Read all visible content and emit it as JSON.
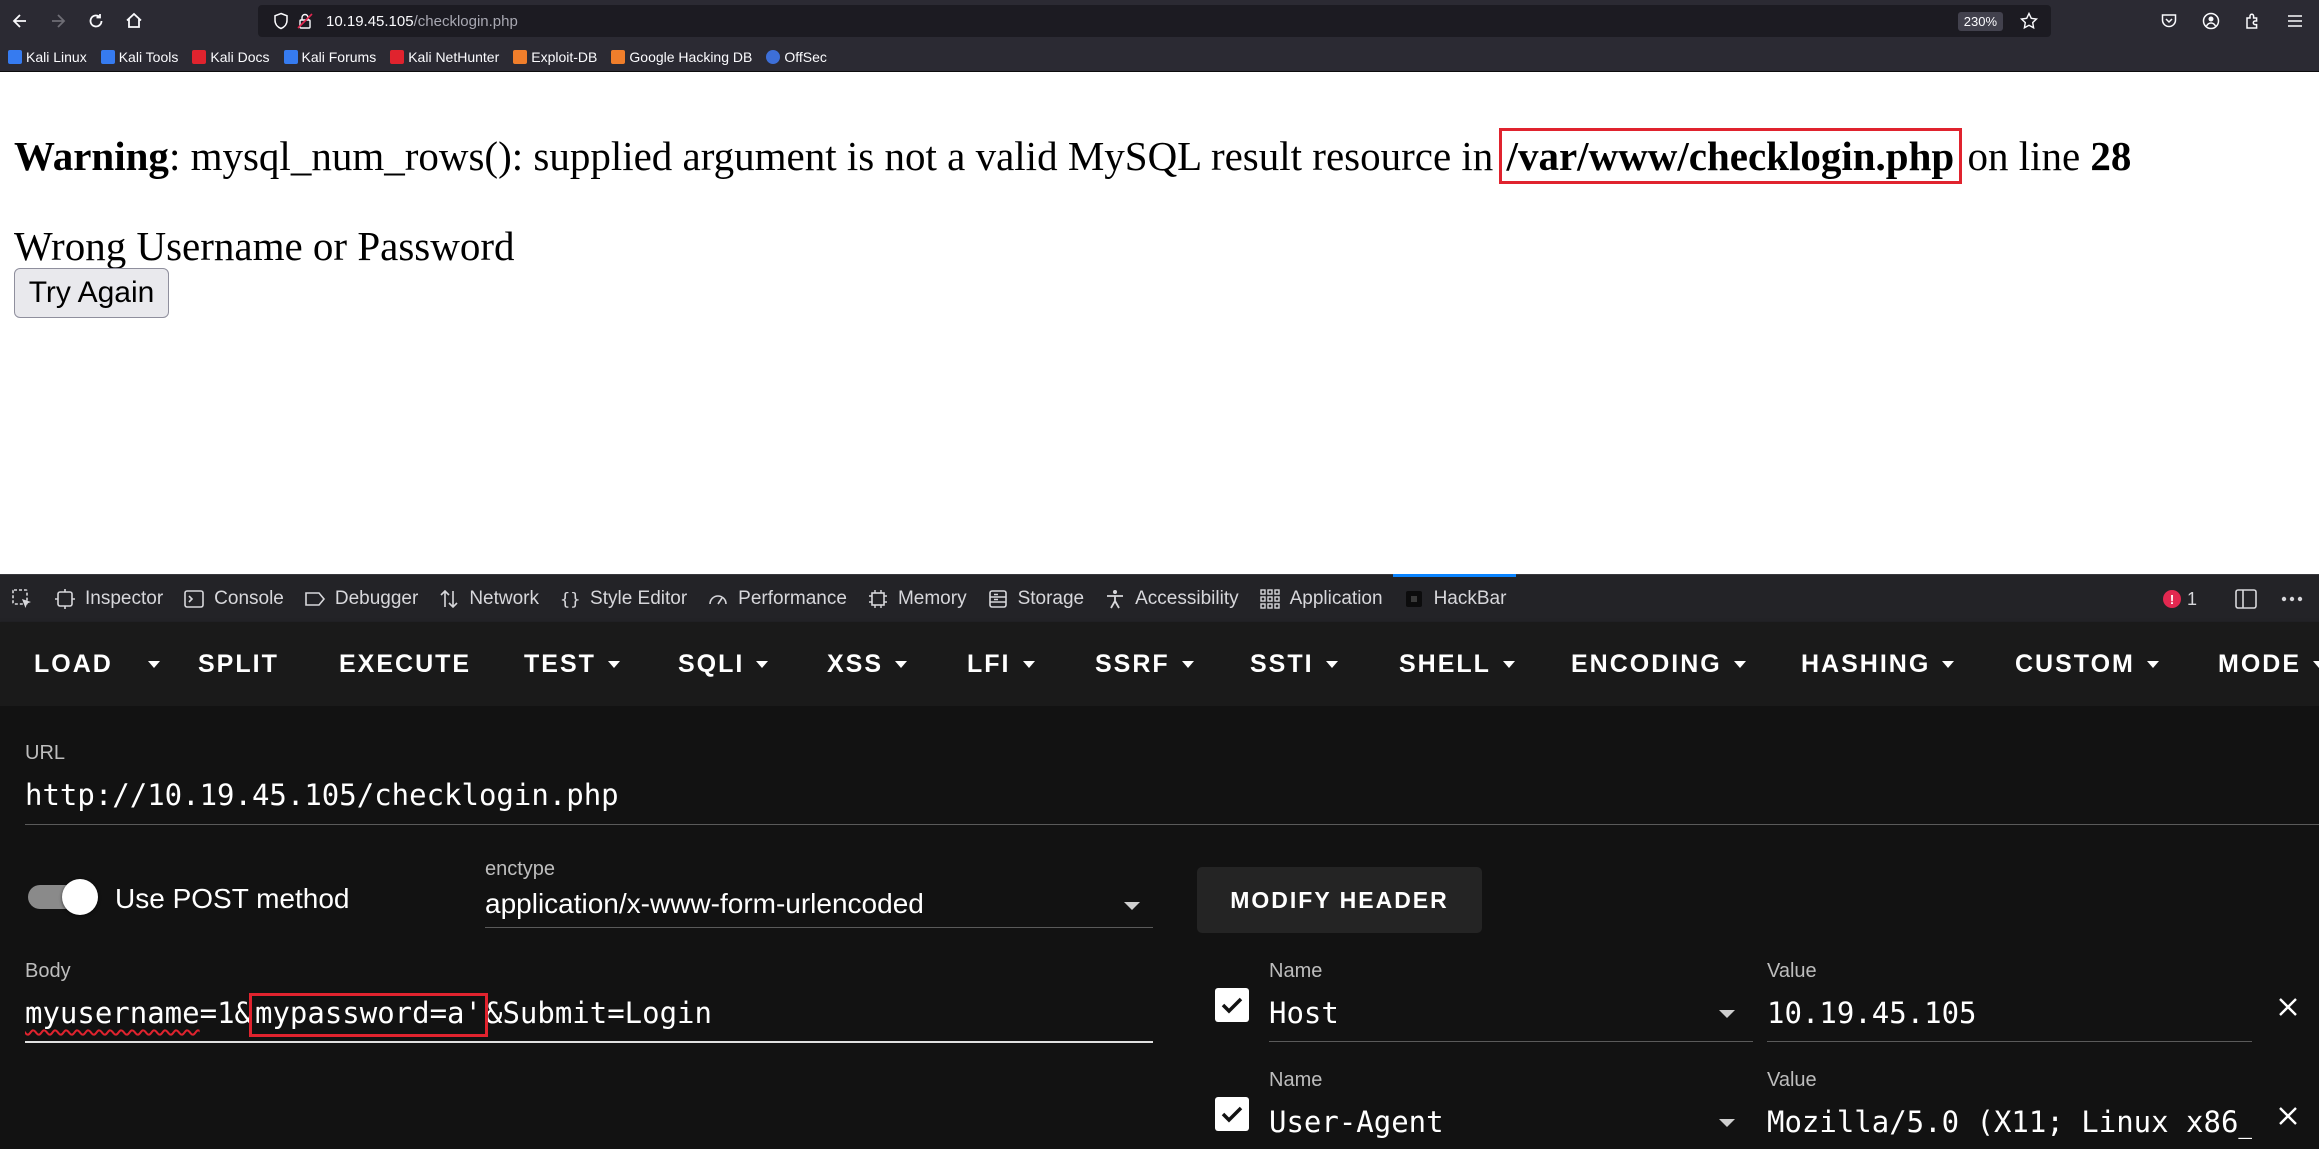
{
  "browser": {
    "url_host": "10.19.45.105",
    "url_path": "/checklogin.php",
    "zoom": "230%",
    "bookmarks": [
      {
        "label": "Kali Linux",
        "color": "#367bf0"
      },
      {
        "label": "Kali Tools",
        "color": "#367bf0"
      },
      {
        "label": "Kali Docs",
        "color": "#e0232e"
      },
      {
        "label": "Kali Forums",
        "color": "#367bf0"
      },
      {
        "label": "Kali NetHunter",
        "color": "#e0232e"
      },
      {
        "label": "Exploit-DB",
        "color": "#f07e2b"
      },
      {
        "label": "Google Hacking DB",
        "color": "#f07e2b"
      },
      {
        "label": "OffSec",
        "color": "#3d6fd8"
      }
    ]
  },
  "page": {
    "warning_label": "Warning",
    "warning_text": ": mysql_num_rows(): supplied argument is not a valid MySQL result resource in ",
    "warning_file": "/var/www/checklogin.php",
    "warning_on_line": " on line ",
    "warning_line": "28",
    "message": "Wrong Username or Password",
    "try_again": "Try Again"
  },
  "devtools": {
    "tabs": [
      "Inspector",
      "Console",
      "Debugger",
      "Network",
      "Style Editor",
      "Performance",
      "Memory",
      "Storage",
      "Accessibility",
      "Application",
      "HackBar"
    ],
    "active_tab": "HackBar",
    "error_count": "1"
  },
  "hackbar": {
    "menu": [
      "LOAD",
      "SPLIT",
      "EXECUTE",
      "TEST",
      "SQLI",
      "XSS",
      "LFI",
      "SSRF",
      "SSTI",
      "SHELL",
      "ENCODING",
      "HASHING",
      "CUSTOM",
      "MODE"
    ],
    "url_label": "URL",
    "url_value": "http://10.19.45.105/checklogin.php",
    "post_label": "Use POST method",
    "post_enabled": true,
    "enctype_label": "enctype",
    "enctype_value": "application/x-www-form-urlencoded",
    "modify_header": "MODIFY HEADER",
    "body_label": "Body",
    "body_part1": "myusername",
    "body_part2": "=1&",
    "body_part3": "mypassword=a'",
    "body_part4": "&Submit=Login",
    "headers": [
      {
        "name_label": "Name",
        "name": "Host",
        "value_label": "Value",
        "value": "10.19.45.105",
        "checked": true
      },
      {
        "name_label": "Name",
        "name": "User-Agent",
        "value_label": "Value",
        "value": "Mozilla/5.0 (X11; Linux x86_",
        "checked": true
      }
    ]
  },
  "colors": {
    "highlight": "#e0232e",
    "active_tab": "#0a84ff",
    "error": "#e22850"
  }
}
